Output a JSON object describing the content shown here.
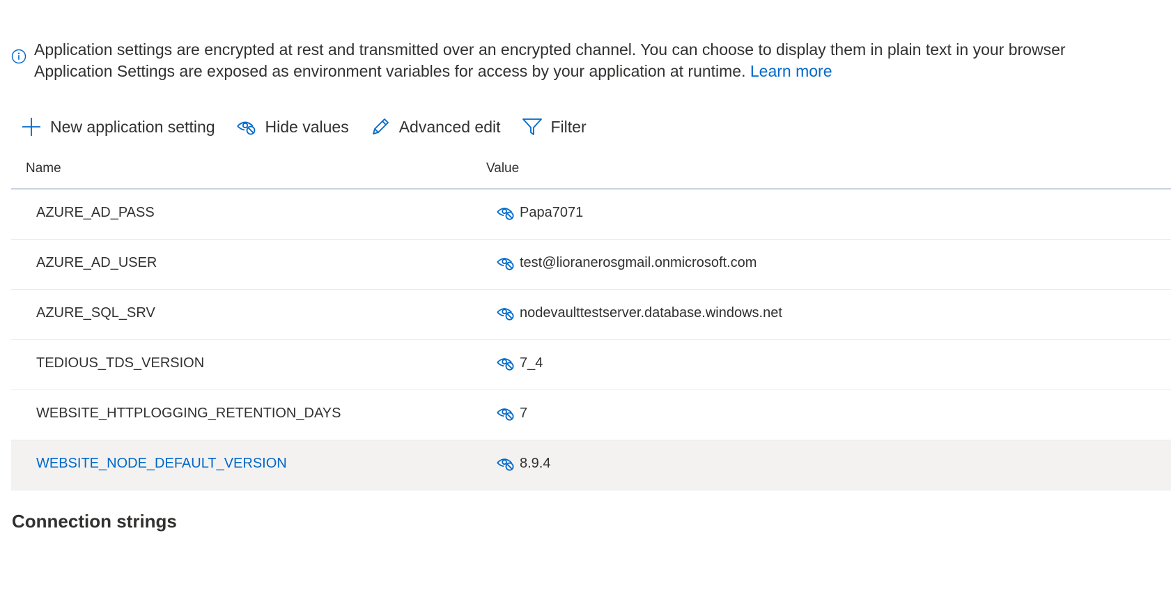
{
  "info": {
    "line1": "Application settings are encrypted at rest and transmitted over an encrypted channel. You can choose to display them in plain text in your browser",
    "line2": "Application Settings are exposed as environment variables for access by your application at runtime. ",
    "learn_more": "Learn more",
    "icon": "info-icon"
  },
  "toolbar": {
    "new_setting_label": "New application setting",
    "hide_values_label": "Hide values",
    "advanced_edit_label": "Advanced edit",
    "filter_label": "Filter"
  },
  "grid": {
    "header": {
      "name": "Name",
      "value": "Value"
    },
    "rows": [
      {
        "name": "AZURE_AD_PASS",
        "value": "Papa7071"
      },
      {
        "name": "AZURE_AD_USER",
        "value": "test@lioranerosgmail.onmicrosoft.com"
      },
      {
        "name": "AZURE_SQL_SRV",
        "value": "nodevaulttestserver.database.windows.net"
      },
      {
        "name": "TEDIOUS_TDS_VERSION",
        "value": "7_4"
      },
      {
        "name": "WEBSITE_HTTPLOGGING_RETENTION_DAYS",
        "value": "7"
      },
      {
        "name": "WEBSITE_NODE_DEFAULT_VERSION",
        "value": "8.9.4"
      }
    ]
  },
  "sections": {
    "connection_strings": "Connection strings"
  },
  "colors": {
    "accent": "#0068c9",
    "text": "#323130",
    "selected_row": "#f3f2f1",
    "header_border": "#c8d4e1"
  }
}
